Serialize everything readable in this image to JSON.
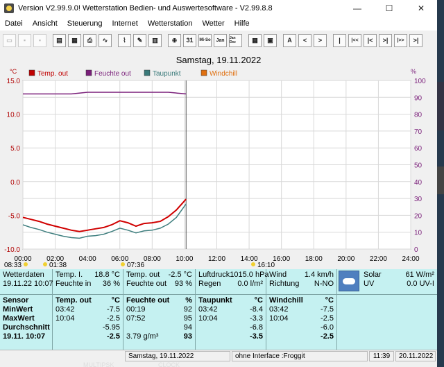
{
  "window": {
    "title": "Version V2.99.9.0!  Wetterstation Bedien- und Auswertesoftware - V2.99.8.8",
    "controls": [
      "—",
      "☐",
      "✕"
    ]
  },
  "menu": [
    "Datei",
    "Ansicht",
    "Steuerung",
    "Internet",
    "Wetterstation",
    "Wetter",
    "Hilfe"
  ],
  "toolbar": {
    "buttons": [
      "",
      "",
      "",
      "",
      "",
      "",
      "",
      "",
      "",
      "",
      "",
      "",
      "31",
      "Mi-So",
      "Jan",
      "Jan Dez",
      "",
      "",
      "A",
      "<",
      ">",
      "|",
      "|<<",
      "|<",
      ">|",
      "|>>",
      ">|"
    ]
  },
  "chart_data": {
    "type": "line",
    "title": "Samstag, 19.11.2022",
    "left_unit": "°C",
    "right_unit": "%",
    "ylim_left": [
      -10.0,
      15.0
    ],
    "yticks_left": [
      "15.0",
      "10.0",
      "5.0",
      "0.0",
      "-5.0",
      "-10.0"
    ],
    "ylim_right": [
      0,
      100
    ],
    "yticks_right": [
      "100",
      "90",
      "80",
      "70",
      "60",
      "50",
      "40",
      "30",
      "20",
      "10",
      "0"
    ],
    "xticks": [
      "00:00",
      "02:00",
      "04:00",
      "06:00",
      "08:00",
      "10:00",
      "12:00",
      "14:00",
      "16:00",
      "18:00",
      "20:00",
      "22:00",
      "24:00"
    ],
    "sun_labels": [
      "08:33",
      "01:38",
      "07:36",
      "16:10"
    ],
    "legend": [
      {
        "name": "Temp. out",
        "color": "#c00000"
      },
      {
        "name": "Feuchte out",
        "color": "#7a1f7a"
      },
      {
        "name": "Taupunkt",
        "color": "#3a7a7a"
      },
      {
        "name": "Windchill",
        "color": "#e07010"
      }
    ],
    "series": [
      {
        "name": "Temp. out",
        "color": "#d00000",
        "x": [
          0,
          0.5,
          1,
          1.5,
          2,
          2.5,
          3,
          3.5,
          4,
          4.5,
          5,
          5.5,
          6,
          6.5,
          7,
          7.5,
          8,
          8.5,
          9,
          9.5,
          10.1
        ],
        "y": [
          -5.3,
          -5.6,
          -5.9,
          -6.3,
          -6.6,
          -6.9,
          -7.2,
          -7.4,
          -7.2,
          -7.0,
          -6.8,
          -6.4,
          -5.8,
          -6.1,
          -6.6,
          -6.2,
          -6.1,
          -5.9,
          -5.2,
          -4.2,
          -2.6
        ]
      },
      {
        "name": "Feuchte out",
        "color": "#7a1f7a",
        "x": [
          0,
          1,
          2,
          3,
          4,
          5,
          6,
          7,
          8,
          9,
          10.1
        ],
        "y": [
          92,
          92,
          92,
          92,
          93,
          93,
          93,
          93,
          93,
          93,
          92
        ]
      },
      {
        "name": "Taupunkt",
        "color": "#3f7f7f",
        "x": [
          0,
          0.5,
          1,
          1.5,
          2,
          2.5,
          3,
          3.5,
          4,
          4.5,
          5,
          5.5,
          6,
          6.5,
          7,
          7.5,
          8,
          8.5,
          9,
          9.5,
          10.1
        ],
        "y": [
          -6.4,
          -6.8,
          -7.1,
          -7.5,
          -7.8,
          -8.1,
          -8.3,
          -8.4,
          -8.1,
          -8.0,
          -7.8,
          -7.4,
          -6.9,
          -7.2,
          -7.6,
          -7.3,
          -7.2,
          -6.9,
          -6.3,
          -5.3,
          -3.3
        ]
      }
    ]
  },
  "panel": {
    "row1": [
      {
        "l1": [
          "Wetterdaten",
          ""
        ],
        "l2": [
          "19.11.22 10:07",
          ""
        ]
      },
      {
        "l1": [
          "Temp. I.",
          "18.8 °C"
        ],
        "l2": [
          "Feuchte in",
          "36 %"
        ]
      },
      {
        "l1": [
          "Temp. out",
          "-2.5 °C"
        ],
        "l2": [
          "Feuchte out",
          "93 %"
        ]
      },
      {
        "l1": [
          "Luftdruck",
          "1015.0 hPa"
        ],
        "l2": [
          "Regen",
          "0.0 l/m²"
        ]
      },
      {
        "l1": [
          "Wind",
          "1.4 km/h"
        ],
        "l2": [
          "Richtung",
          "N-NO"
        ]
      },
      {
        "l1": [
          "Solar",
          "61 W/m²"
        ],
        "l2": [
          "UV",
          "0.0 UV-I"
        ]
      }
    ],
    "row2": {
      "labels": [
        "Sensor",
        "MinWert",
        "MaxWert",
        "Durchschnitt",
        "19.11. 10:07"
      ],
      "temp": {
        "header": [
          "Temp. out",
          "°C"
        ],
        "rows": [
          [
            "03:42",
            "-7.5"
          ],
          [
            "10:04",
            "-2.5"
          ],
          [
            "",
            "-5.95"
          ],
          [
            "",
            "-2.5"
          ]
        ]
      },
      "feuchte": {
        "header": [
          "Feuchte out",
          "%"
        ],
        "rows": [
          [
            "00:19",
            "92"
          ],
          [
            "07:52",
            "95"
          ],
          [
            "",
            "94"
          ],
          [
            "3.79 g/m³",
            "93"
          ]
        ]
      },
      "taupunkt": {
        "header": [
          "Taupunkt",
          "°C"
        ],
        "rows": [
          [
            "03:42",
            "-8.4"
          ],
          [
            "10:04",
            "-3.3"
          ],
          [
            "",
            "-6.8"
          ],
          [
            "",
            "-3.5"
          ]
        ]
      },
      "windchill": {
        "header": [
          "Windchill",
          "°C"
        ],
        "rows": [
          [
            "03:42",
            "-7.5"
          ],
          [
            "10:04",
            "-2.5"
          ],
          [
            "",
            "-6.0"
          ],
          [
            "",
            "-2.5"
          ]
        ]
      }
    }
  },
  "statusbar": {
    "date": "Samstag, 19.11.2022",
    "interface": "ohne Interface :Froggit",
    "time": "11:39",
    "today": "20.11.2022"
  },
  "desktop": {
    "left": "MULTIPSK",
    "right": "CLOCK"
  }
}
